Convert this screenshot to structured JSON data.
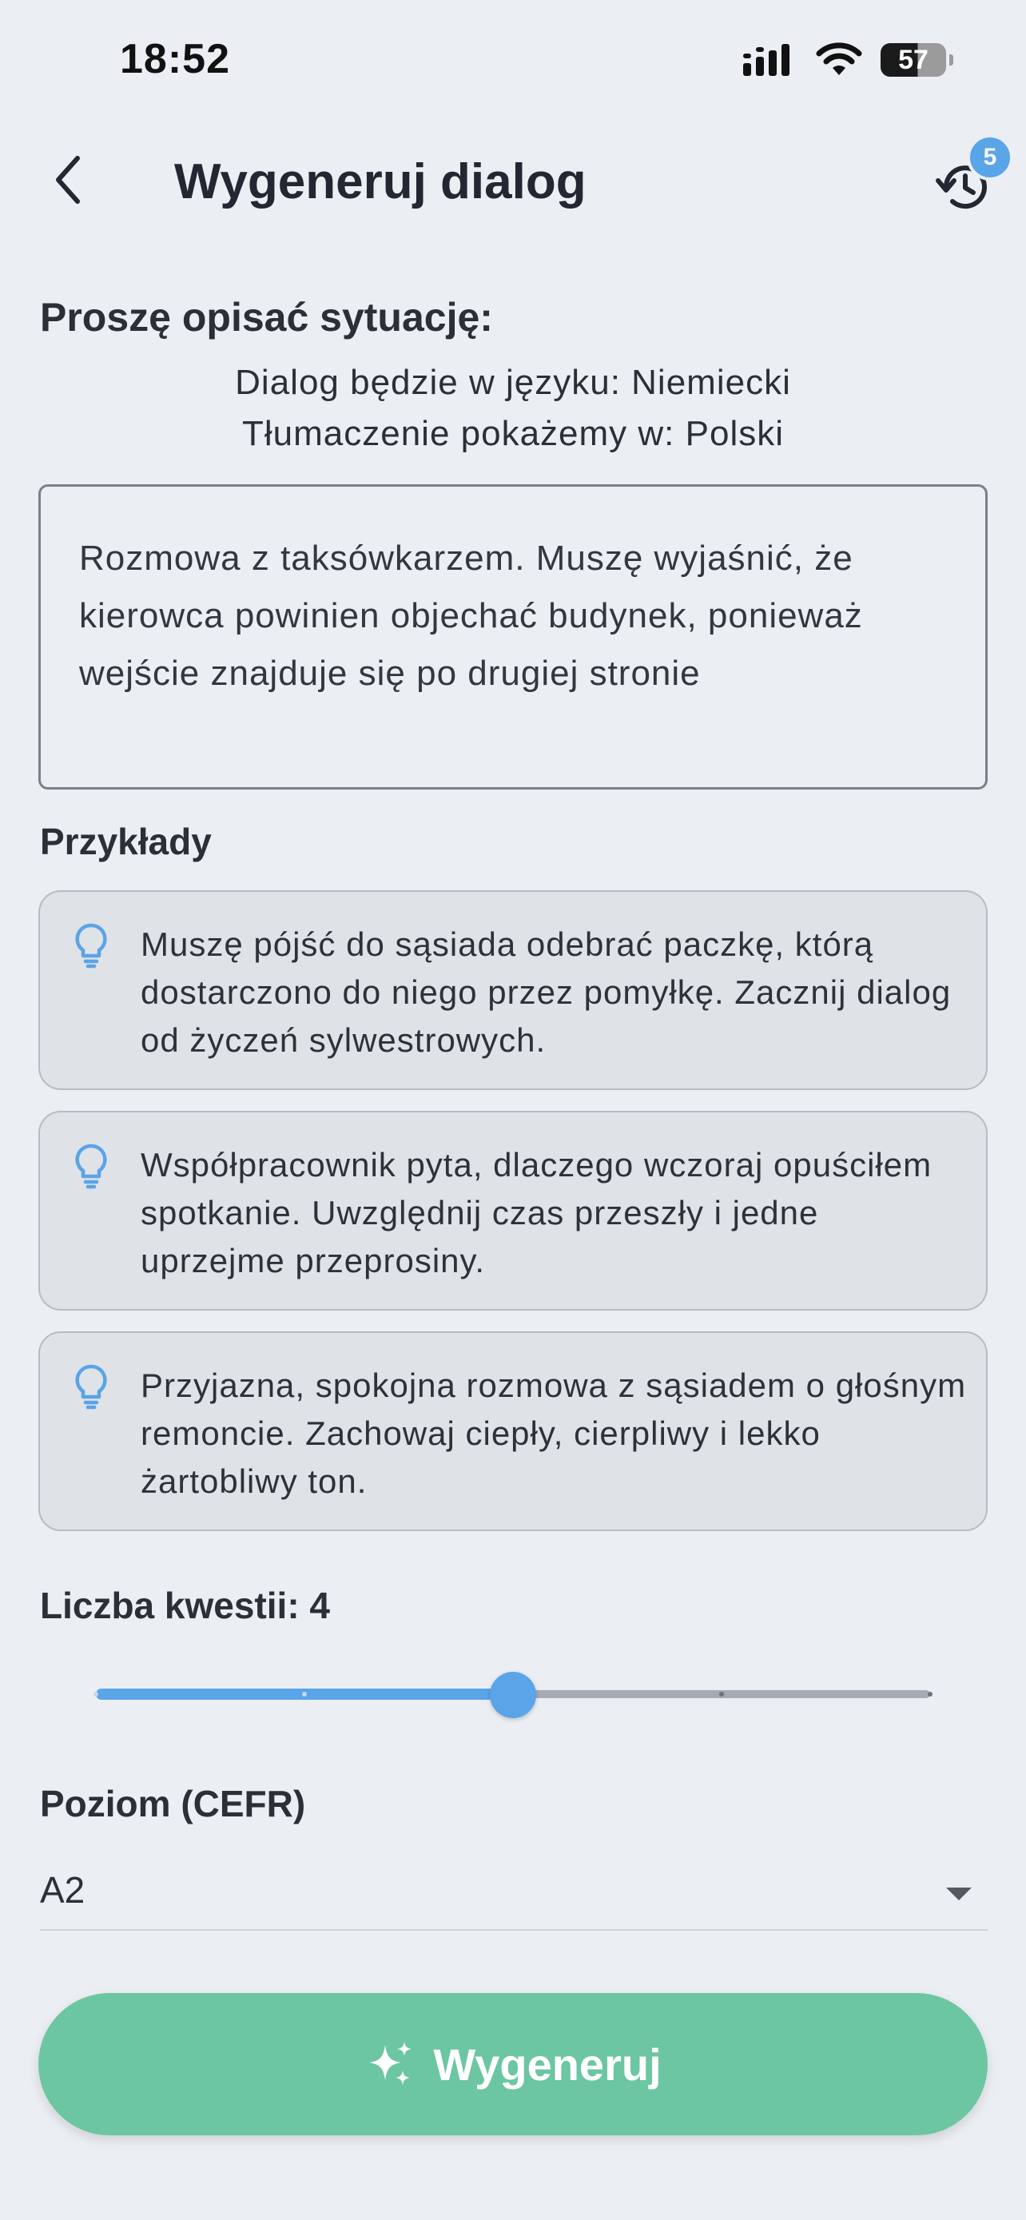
{
  "status_bar": {
    "time": "18:52",
    "battery": "57"
  },
  "header": {
    "title": "Wygeneruj dialog",
    "history_badge": "5",
    "back_icon": "chevron-left-icon",
    "history_icon": "history-icon"
  },
  "situation": {
    "heading": "Proszę opisać sytuację:",
    "dialog_language_line": "Dialog będzie w języku: Niemiecki",
    "translation_line": "Tłumaczenie pokażemy w: Polski",
    "text": "Rozmowa z taksówkarzem. Muszę wyjaśnić, że kierowca powinien objechać budynek, ponieważ wejście znajduje się po drugiej stronie"
  },
  "examples": {
    "label": "Przykłady",
    "items": [
      {
        "text": "Muszę pójść do sąsiada odebrać paczkę, którą dostarczono do niego przez pomyłkę. Zacznij dialog od życzeń sylwestrowych."
      },
      {
        "text": "Współpracownik pyta, dlaczego wczoraj opuściłem spotkanie. Uwzględnij czas przeszły i jedne uprzejme przeprosiny."
      },
      {
        "text": "Przyjazna, spokojna rozmowa z sąsiadem o głośnym remoncie. Zachowaj ciepły, cierpliwy i lekko żartobliwy ton."
      }
    ]
  },
  "turns": {
    "label": "Liczba kwestii: 4",
    "value": 4,
    "min": 2,
    "max": 6
  },
  "level": {
    "label": "Poziom (CEFR)",
    "value": "A2"
  },
  "generate": {
    "label": "Wygeneruj",
    "icon": "sparkles-icon"
  },
  "colors": {
    "accent": "#5aa4e8",
    "primary_button": "#6cc6a2",
    "background": "#ebeef2",
    "card": "#dfe2e7"
  }
}
